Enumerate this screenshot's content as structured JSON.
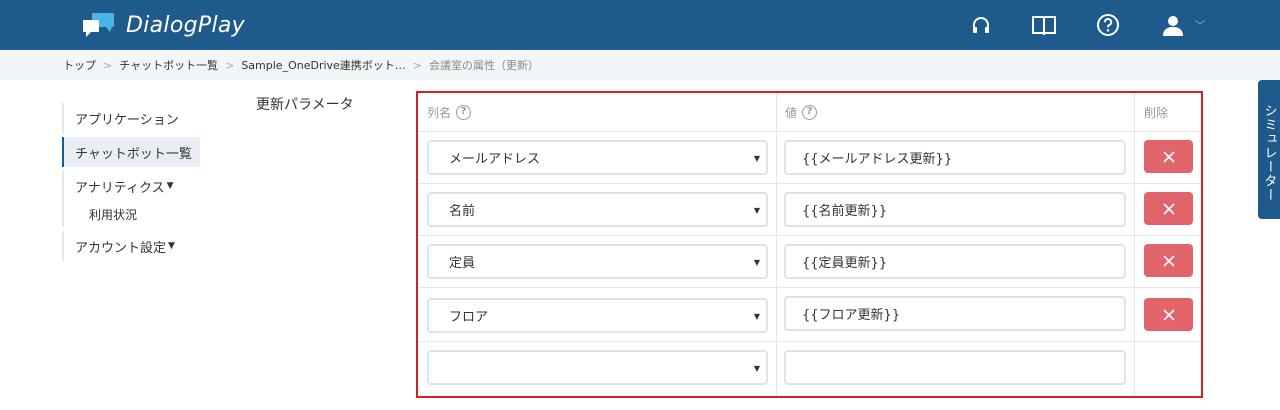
{
  "app": {
    "title": "DialogPlay"
  },
  "colors": {
    "brand": "#1f5a8c",
    "danger_frame": "#d32226",
    "delete_button": "#e1646a"
  },
  "header": {
    "icons": [
      "headset-icon",
      "book-icon",
      "help-circle-icon",
      "user-icon"
    ]
  },
  "breadcrumb": {
    "items": [
      "トップ",
      "チャットボット一覧",
      "Sample_OneDrive連携ボット…",
      "会議室の属性（更新）"
    ]
  },
  "sidebar": {
    "items": [
      {
        "label": "アプリケーション",
        "active": false
      },
      {
        "label": "チャットボット一覧",
        "active": true
      },
      {
        "label": "アナリティクス",
        "dropdown": true,
        "children": [
          "利用状況"
        ]
      },
      {
        "label": "アカウント設定",
        "dropdown": true
      }
    ]
  },
  "main": {
    "section_label": "更新パラメータ",
    "columns": {
      "name": "列名",
      "value": "値",
      "delete": "削除"
    },
    "rows": [
      {
        "column": "メールアドレス",
        "value": "{{メールアドレス更新}}",
        "deletable": true
      },
      {
        "column": "名前",
        "value": "{{名前更新}}",
        "deletable": true
      },
      {
        "column": "定員",
        "value": "{{定員更新}}",
        "deletable": true
      },
      {
        "column": "フロア",
        "value": "{{フロア更新}}",
        "deletable": true
      },
      {
        "column": "",
        "value": "",
        "deletable": false
      }
    ]
  },
  "simulator": {
    "label": "シミュレーター"
  }
}
